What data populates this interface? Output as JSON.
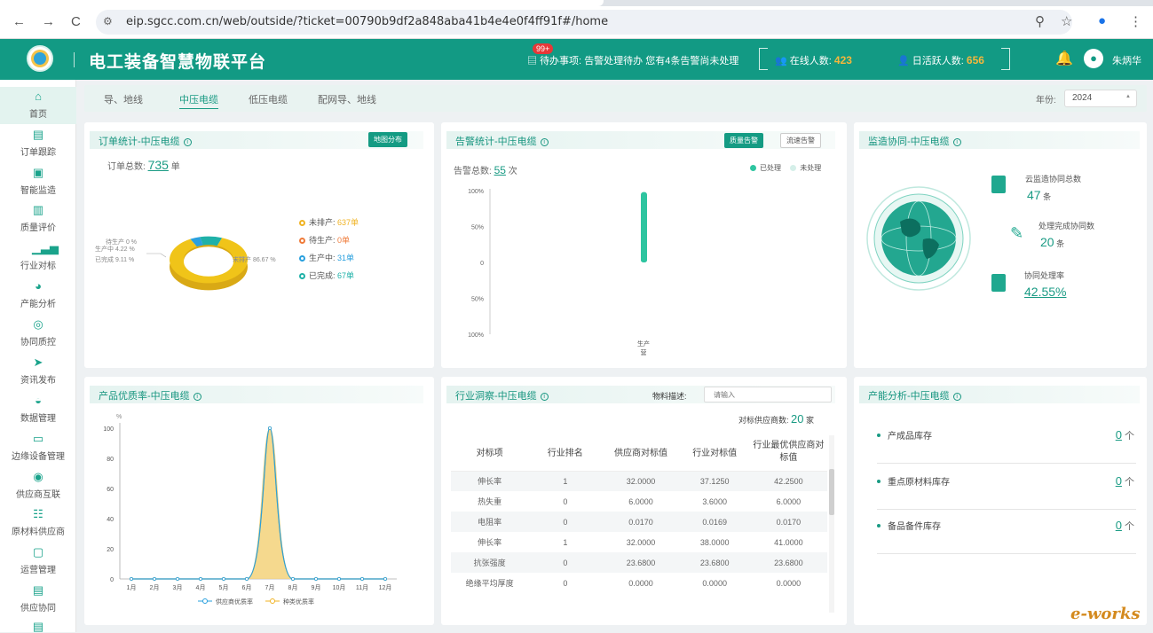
{
  "browser": {
    "back": "←",
    "forward": "→",
    "reload": "C",
    "url": "eip.sgcc.com.cn/web/outside/?ticket=00790b9df2a848aba41b4e4e0f4ff91f#/home"
  },
  "header": {
    "title": "电工装备智慧物联平台",
    "badge": "99+",
    "todo_label": "待办事项:",
    "todo_text": "告警处理待办 您有4条告警尚未处理",
    "online_label": "在线人数:",
    "online_count": "423",
    "daily_label": "日活跃人数:",
    "daily_count": "656",
    "user": "朱炳华"
  },
  "sidebar": {
    "items": [
      {
        "label": "首页",
        "icon": "home-icon"
      },
      {
        "label": "订单跟踪",
        "icon": "order-icon"
      },
      {
        "label": "智能监造",
        "icon": "monitor-icon"
      },
      {
        "label": "质量评价",
        "icon": "quality-icon"
      },
      {
        "label": "行业对标",
        "icon": "bar-icon"
      },
      {
        "label": "产能分析",
        "icon": "pie-icon"
      },
      {
        "label": "协同质控",
        "icon": "target-icon"
      },
      {
        "label": "资讯发布",
        "icon": "send-icon"
      },
      {
        "label": "数据管理",
        "icon": "database-icon"
      },
      {
        "label": "边缘设备管理",
        "icon": "device-icon"
      },
      {
        "label": "供应商互联",
        "icon": "link-icon"
      },
      {
        "label": "原材料供应商",
        "icon": "material-icon"
      },
      {
        "label": "运营管理",
        "icon": "ops-icon"
      },
      {
        "label": "供应协同",
        "icon": "supply-icon"
      }
    ]
  },
  "tabs": [
    "导、地线",
    "中压电缆",
    "低压电缆",
    "配网导、地线"
  ],
  "year": {
    "label": "年份:",
    "value": "2024"
  },
  "order_card": {
    "title": "订单统计-中压电缆",
    "button": "地图分布",
    "total_label": "订单总数:",
    "total": "735",
    "unit": "单",
    "legend": [
      {
        "label": "未排产:",
        "value": "637单",
        "color": "#f0b323"
      },
      {
        "label": "待生产:",
        "value": "0单",
        "color": "#ef7b3a"
      },
      {
        "label": "生产中:",
        "value": "31单",
        "color": "#2aa0de"
      },
      {
        "label": "已完成:",
        "value": "67单",
        "color": "#1fb1a8"
      }
    ],
    "slice_labels": [
      "待生产 0 %",
      "生产中 4.22 %",
      "已完成 9.11 %",
      "未排产 86.67 %"
    ]
  },
  "alarm_card": {
    "title": "告警统计-中压电缆",
    "btn_active": "质量告警",
    "btn_other": "流速告警",
    "total_label": "告警总数:",
    "total": "55",
    "unit": "次",
    "legend": [
      "已处理",
      "未处理"
    ]
  },
  "monitor_card": {
    "title": "监造协同-中压电缆",
    "items": [
      {
        "label": "云监造协同总数",
        "value": "47",
        "unit": "条"
      },
      {
        "label": "处理完成协同数",
        "value": "20",
        "unit": "条"
      },
      {
        "label": "协同处理率",
        "value": "42.55%",
        "unit": ""
      }
    ]
  },
  "quality_card": {
    "title": "产品优质率-中压电缆",
    "legend": [
      "供应商优质率",
      "种类优质率"
    ]
  },
  "insight_card": {
    "title": "行业洞察-中压电缆",
    "search_label": "物料描述:",
    "search_placeholder": "请输入",
    "vendor_label": "对标供应商数:",
    "vendor_count": "20",
    "vendor_unit": "家",
    "headers": [
      "对标项",
      "行业排名",
      "供应商对标值",
      "行业对标值",
      "行业最优供应商对标值"
    ],
    "rows": [
      [
        "伸长率",
        "1",
        "32.0000",
        "37.1250",
        "42.2500"
      ],
      [
        "热失重",
        "0",
        "6.0000",
        "3.6000",
        "6.0000"
      ],
      [
        "电阻率",
        "0",
        "0.0170",
        "0.0169",
        "0.0170"
      ],
      [
        "伸长率",
        "1",
        "32.0000",
        "38.0000",
        "41.0000"
      ],
      [
        "抗张强度",
        "0",
        "23.6800",
        "23.6800",
        "23.6800"
      ],
      [
        "绝缘平均厚度",
        "0",
        "0.0000",
        "0.0000",
        "0.0000"
      ]
    ]
  },
  "capacity_card": {
    "title": "产能分析-中压电缆",
    "items": [
      {
        "label": "产成品库存",
        "value": "0",
        "unit": "个"
      },
      {
        "label": "重点原材料库存",
        "value": "0",
        "unit": "个"
      },
      {
        "label": "备品备件库存",
        "value": "0",
        "unit": "个"
      }
    ]
  },
  "watermark": "e-works",
  "chart_data": [
    {
      "type": "pie",
      "title": "订单统计-中压电缆",
      "categories": [
        "未排产",
        "待生产",
        "生产中",
        "已完成"
      ],
      "values": [
        86.67,
        0,
        4.22,
        9.11
      ],
      "colors": [
        "#f0c419",
        "#ef7b3a",
        "#2aa0de",
        "#1fb1a8"
      ]
    },
    {
      "type": "bar",
      "title": "告警统计-中压电缆",
      "categories": [
        "生产营"
      ],
      "series": [
        {
          "name": "已处理",
          "values": [
            55
          ]
        },
        {
          "name": "未处理",
          "values": [
            0
          ]
        }
      ],
      "yticks": [
        "100%",
        "50%",
        "0",
        "50%",
        "100%"
      ]
    },
    {
      "type": "line",
      "title": "产品优质率-中压电缆",
      "ylabel": "%",
      "ylim": [
        0,
        100
      ],
      "yticks": [
        0,
        20,
        40,
        60,
        80,
        100
      ],
      "categories": [
        "1月",
        "2月",
        "3月",
        "4月",
        "5月",
        "6月",
        "7月",
        "8月",
        "9月",
        "10月",
        "11月",
        "12月"
      ],
      "series": [
        {
          "name": "供应商优质率",
          "values": [
            0,
            0,
            0,
            0,
            0,
            0,
            100,
            0,
            0,
            0,
            0,
            0
          ],
          "color": "#2aa0de"
        },
        {
          "name": "种类优质率",
          "values": [
            0,
            0,
            0,
            0,
            0,
            0,
            100,
            0,
            0,
            0,
            0,
            0
          ],
          "color": "#f0b323"
        }
      ]
    }
  ]
}
